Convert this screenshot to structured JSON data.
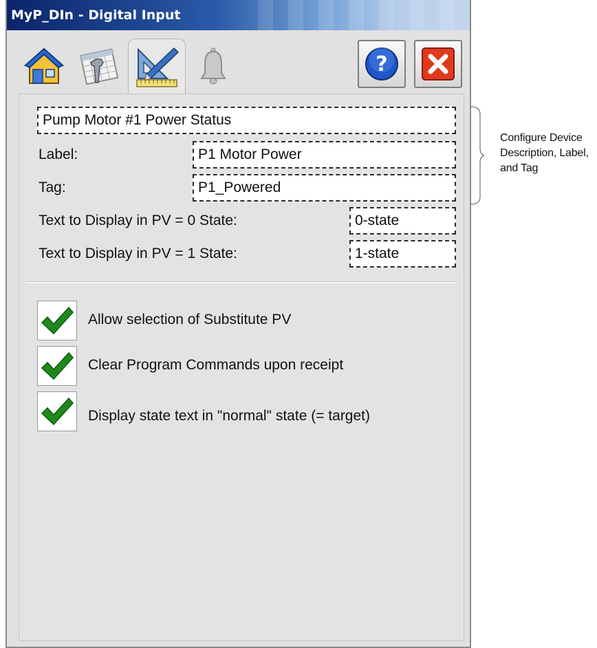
{
  "window": {
    "title": "MyP_DIn - Digital Input"
  },
  "tabs": [
    {
      "name": "home-tab",
      "icon": "home-icon"
    },
    {
      "name": "maintenance-tab",
      "icon": "calendar-wrench-icon"
    },
    {
      "name": "engineering-tab",
      "icon": "ruler-pencil-icon",
      "active": true
    },
    {
      "name": "alarms-tab",
      "icon": "bell-icon"
    }
  ],
  "toolbar": {
    "help_icon": "help-icon",
    "close_icon": "close-icon"
  },
  "config": {
    "description": "Pump Motor #1 Power Status",
    "label_caption": "Label:",
    "label_value": "P1 Motor Power",
    "tag_caption": "Tag:",
    "tag_value": "P1_Powered",
    "state0_caption": "Text to Display in PV = 0 State:",
    "state0_value": "0-state",
    "state1_caption": "Text to Display in PV = 1 State:",
    "state1_value": "1-state"
  },
  "options": [
    {
      "label": "Allow selection of Substitute PV",
      "checked": true
    },
    {
      "label": "Clear Program Commands upon receipt",
      "checked": true
    },
    {
      "label": "Display state text in \"normal\" state (= target)",
      "checked": true
    }
  ],
  "annotation": {
    "line1": "Configure Device",
    "line2": "Description, Label,",
    "line3": "and Tag"
  },
  "colors": {
    "check_green": "#1e8a1e",
    "close_red": "#e03a1c",
    "help_blue": "#1f56c8",
    "title_bar": "#0a246a"
  }
}
